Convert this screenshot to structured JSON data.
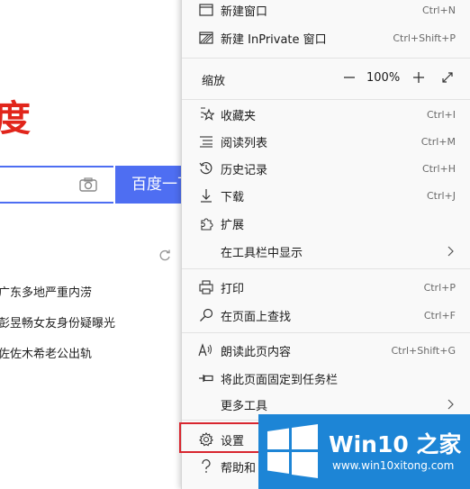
{
  "background": {
    "logo_partial": "度",
    "search_button": "百度一下",
    "hot_list": [
      "广东多地严重内涝",
      "彭昱畅女友身份疑曝光",
      "佐佐木希老公出轨"
    ]
  },
  "menu": {
    "items": [
      {
        "label": "新建窗口",
        "shortcut": "Ctrl+N",
        "icon": "new-window-icon"
      },
      {
        "label": "新建 InPrivate 窗口",
        "shortcut": "Ctrl+Shift+P",
        "icon": "inprivate-icon"
      },
      {
        "label": "收藏夹",
        "shortcut": "Ctrl+I",
        "icon": "favorites-icon"
      },
      {
        "label": "阅读列表",
        "shortcut": "Ctrl+M",
        "icon": "reading-list-icon"
      },
      {
        "label": "历史记录",
        "shortcut": "Ctrl+H",
        "icon": "history-icon"
      },
      {
        "label": "下载",
        "shortcut": "Ctrl+J",
        "icon": "download-icon"
      },
      {
        "label": "扩展",
        "shortcut": "",
        "icon": "extensions-icon"
      },
      {
        "label": "在工具栏中显示",
        "shortcut": "",
        "icon": ""
      },
      {
        "label": "打印",
        "shortcut": "Ctrl+P",
        "icon": "print-icon"
      },
      {
        "label": "在页面上查找",
        "shortcut": "Ctrl+F",
        "icon": "search-icon"
      },
      {
        "label": "朗读此页内容",
        "shortcut": "Ctrl+Shift+G",
        "icon": "read-aloud-icon"
      },
      {
        "label": "将此页面固定到任务栏",
        "shortcut": "",
        "icon": "pin-icon"
      },
      {
        "label": "更多工具",
        "shortcut": "",
        "icon": ""
      },
      {
        "label": "设置",
        "shortcut": "",
        "icon": "gear-icon"
      },
      {
        "label": "帮助和",
        "shortcut": "",
        "icon": "help-icon"
      }
    ],
    "zoom": {
      "label": "缩放",
      "value": "100%"
    }
  },
  "watermark": {
    "title": "Win10 之家",
    "url": "www.win10xitong.com"
  }
}
